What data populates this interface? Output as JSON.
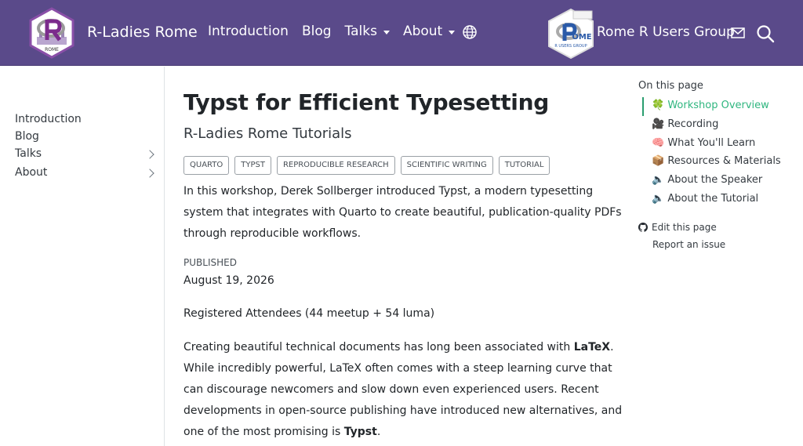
{
  "navbar": {
    "brand": "R-Ladies Rome",
    "links": [
      "Introduction",
      "Blog",
      "Talks",
      "About"
    ],
    "rome_group": "Rome R Users Group",
    "logo_text": "ROME",
    "rome_logo_text": "R USERS GROUP"
  },
  "sidebar": {
    "items": [
      "Introduction",
      "Blog",
      "Talks",
      "About"
    ]
  },
  "main": {
    "title": "Typst for Efficient Typesetting",
    "subtitle": "R-Ladies Rome Tutorials",
    "categories": [
      "QUARTO",
      "TYPST",
      "REPRODUCIBLE RESEARCH",
      "SCIENTIFIC WRITING",
      "TUTORIAL"
    ],
    "intro": "In this workshop, Derek Sollberger introduced Typst, a modern typesetting system that integrates with Quarto to create beautiful, publication-quality PDFs through reproducible workflows.",
    "published_label": "PUBLISHED",
    "published_date": "August 19, 2026",
    "attendees": "Registered Attendees (44 meetup + 54 luma)",
    "body_1": "Creating beautiful technical documents has long been associated with ",
    "body_latex": "LaTeX",
    "body_2": ". While incredibly powerful, LaTeX often comes with a steep learning curve that can discourage newcomers and slow down even experienced users. Recent developments in open-source publishing have introduced new alternatives, and one of the most promising is ",
    "body_typst": "Typst",
    "body_3": "."
  },
  "toc": {
    "title": "On this page",
    "items": [
      {
        "emoji": "🍀",
        "label": "Workshop Overview"
      },
      {
        "emoji": "🎥",
        "label": "Recording"
      },
      {
        "emoji": "🧠",
        "label": "What You'll Learn"
      },
      {
        "emoji": "📦",
        "label": "Resources & Materials"
      },
      {
        "emoji": "🔈",
        "label": "About the Speaker"
      },
      {
        "emoji": "🔈",
        "label": "About the Tutorial"
      }
    ],
    "edit_page": "Edit this page",
    "report_issue": "Report an issue"
  },
  "colors": {
    "navbar": "#5a4a8a",
    "toc_active": "#2fb67f"
  }
}
